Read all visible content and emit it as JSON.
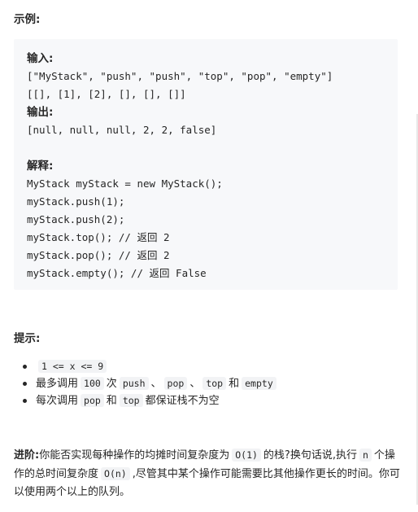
{
  "example_heading": "示例:",
  "input_label": "输入:",
  "input_ops": "[\"MyStack\", \"push\", \"push\", \"top\", \"pop\", \"empty\"]",
  "input_args": "[[], [1], [2], [], [], []]",
  "output_label": "输出:",
  "output_value": "[null, null, null, 2, 2, false]",
  "explain_label": "解释:",
  "explain_lines": [
    "MyStack myStack = new MyStack();",
    "myStack.push(1);",
    "myStack.push(2);",
    "myStack.top(); // 返回 2",
    "myStack.pop(); // 返回 2",
    "myStack.empty(); // 返回 False"
  ],
  "hints_heading": "提示:",
  "hints": [
    {
      "code": "1 <= x <= 9"
    },
    {
      "text1": "最多调用",
      "code1": "100",
      "text2": "次",
      "code2": "push",
      "sep1": "、",
      "code3": "pop",
      "sep2": "、",
      "code4": "top",
      "text3": "和",
      "code5": "empty"
    },
    {
      "text1": "每次调用",
      "code1": "pop",
      "text2": "和",
      "code2": "top",
      "text3": "都保证栈不为空"
    }
  ],
  "followup": {
    "label": "进阶:",
    "text1": "你能否实现每种操作的均摊时间复杂度为",
    "code1": "O(1)",
    "text2": "的栈?换句话说,执行",
    "code2": "n",
    "text3": "个操作的总时间复杂度",
    "code3": "O(n)",
    "text4": ",尽管其中某个操作可能需要比其他操作更长的时间。你可以使用两个以上的队列。"
  }
}
